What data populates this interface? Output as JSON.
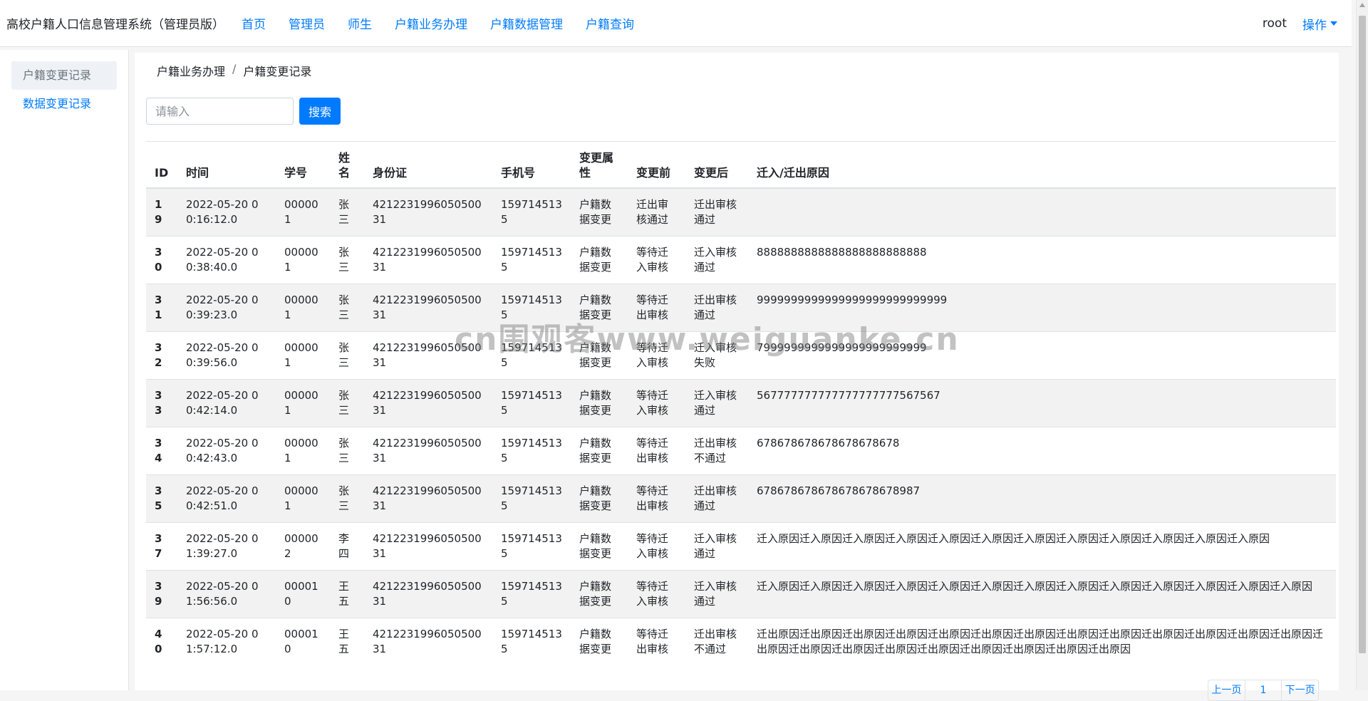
{
  "navbar": {
    "brand": "高校户籍人口信息管理系统（管理员版）",
    "links": [
      "首页",
      "管理员",
      "师生",
      "户籍业务办理",
      "户籍数据管理",
      "户籍查询"
    ],
    "user": "root",
    "ops_label": "操作"
  },
  "sidebar": {
    "items": [
      "户籍变更记录",
      "数据变更记录"
    ]
  },
  "breadcrumb": {
    "items": [
      "户籍业务办理",
      "户籍变更记录"
    ],
    "separator": "/"
  },
  "search": {
    "placeholder": "请输入",
    "button_label": "搜索"
  },
  "table": {
    "headers": [
      "ID",
      "时间",
      "学号",
      "姓名",
      "身份证",
      "手机号",
      "变更属性",
      "变更前",
      "变更后",
      "迁入/迁出原因"
    ],
    "rows": [
      [
        "19",
        "2022-05-20 00:16:12.0",
        "000001",
        "张三",
        "421223199605050031",
        "1597145135",
        "户籍数据变更",
        "迁出审核通过",
        "迁出审核通过",
        ""
      ],
      [
        "30",
        "2022-05-20 00:38:40.0",
        "000001",
        "张三",
        "421223199605050031",
        "1597145135",
        "户籍数据变更",
        "等待迁入审核",
        "迁入审核通过",
        "8888888888888888888888888"
      ],
      [
        "31",
        "2022-05-20 00:39:23.0",
        "000001",
        "张三",
        "421223199605050031",
        "1597145135",
        "户籍数据变更",
        "等待迁出审核",
        "迁出审核通过",
        "9999999999999999999999999999"
      ],
      [
        "32",
        "2022-05-20 00:39:56.0",
        "000001",
        "张三",
        "421223199605050031",
        "1597145135",
        "户籍数据变更",
        "等待迁入审核",
        "迁入审核失败",
        "7999999999999999999999999"
      ],
      [
        "33",
        "2022-05-20 00:42:14.0",
        "000001",
        "张三",
        "421223199605050031",
        "1597145135",
        "户籍数据变更",
        "等待迁入审核",
        "迁入审核通过",
        "567777777777777777777567567"
      ],
      [
        "34",
        "2022-05-20 00:42:43.0",
        "000001",
        "张三",
        "421223199605050031",
        "1597145135",
        "户籍数据变更",
        "等待迁出审核",
        "迁出审核不通过",
        "678678678678678678678"
      ],
      [
        "35",
        "2022-05-20 00:42:51.0",
        "000001",
        "张三",
        "421223199605050031",
        "1597145135",
        "户籍数据变更",
        "等待迁出审核",
        "迁出审核通过",
        "678678678678678678678987"
      ],
      [
        "37",
        "2022-05-20 01:39:27.0",
        "000002",
        "李四",
        "421223199605050031",
        "1597145135",
        "户籍数据变更",
        "等待迁入审核",
        "迁入审核通过",
        "迁入原因迁入原因迁入原因迁入原因迁入原因迁入原因迁入原因迁入原因迁入原因迁入原因迁入原因迁入原因"
      ],
      [
        "39",
        "2022-05-20 01:56:56.0",
        "000010",
        "王五",
        "421223199605050031",
        "1597145135",
        "户籍数据变更",
        "等待迁入审核",
        "迁入审核通过",
        "迁入原因迁入原因迁入原因迁入原因迁入原因迁入原因迁入原因迁入原因迁入原因迁入原因迁入原因迁入原因迁入原因"
      ],
      [
        "40",
        "2022-05-20 01:57:12.0",
        "000010",
        "王五",
        "421223199605050031",
        "1597145135",
        "户籍数据变更",
        "等待迁出审核",
        "迁出审核不通过",
        "迁出原因迁出原因迁出原因迁出原因迁出原因迁出原因迁出原因迁出原因迁出原因迁出原因迁出原因迁出原因迁出原因迁出原因迁出原因迁出原因迁出原因迁出原因迁出原因迁出原因迁出原因迁出原因"
      ]
    ]
  },
  "pager": {
    "items": [
      "上一页",
      "1",
      "下一页"
    ]
  },
  "watermark": "cn围观客www.weiguanke.cn",
  "colors": {
    "accent": "#007bff",
    "stripe": "#f2f2f2"
  }
}
